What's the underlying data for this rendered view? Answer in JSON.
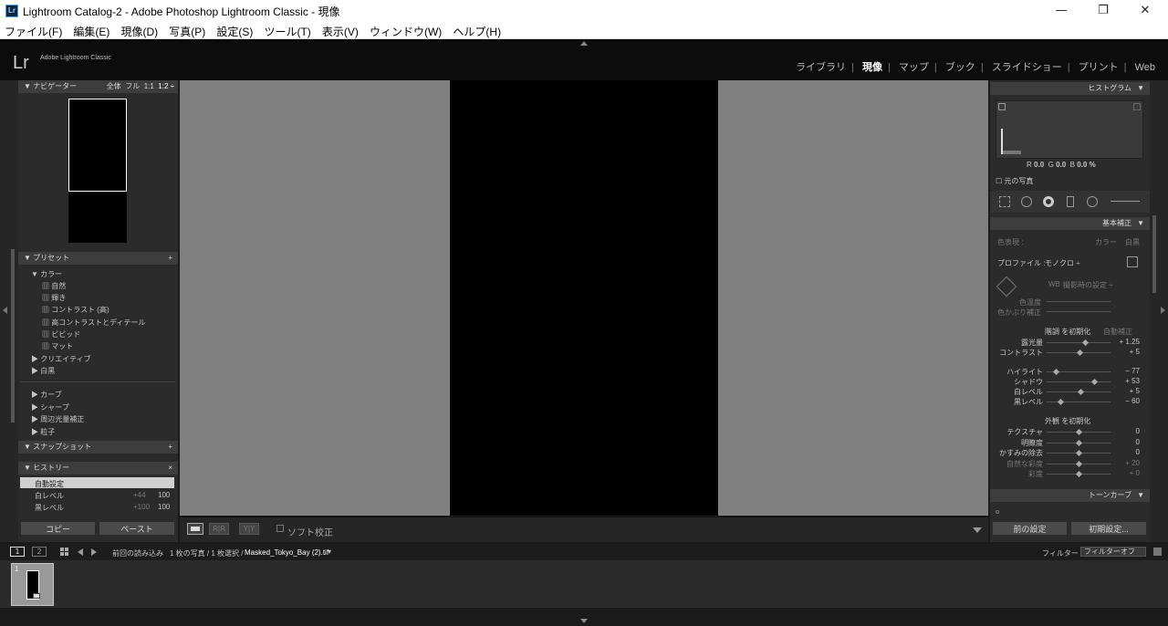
{
  "window": {
    "app_icon": "Lr",
    "title": "Lightroom Catalog-2 - Adobe Photoshop Lightroom Classic - 現像",
    "minimize": "—",
    "maximize": "❐",
    "close": "✕"
  },
  "menu": [
    "ファイル(F)",
    "編集(E)",
    "現像(D)",
    "写真(P)",
    "設定(S)",
    "ツール(T)",
    "表示(V)",
    "ウィンドウ(W)",
    "ヘルプ(H)"
  ],
  "identity": {
    "logo": "Lr",
    "name": "Adobe Lightroom Classic"
  },
  "modules": [
    "ライブラリ",
    "現像",
    "マップ",
    "ブック",
    "スライドショー",
    "プリント",
    "Web"
  ],
  "active_module": "現像",
  "navigator": {
    "title": "ナビゲーター",
    "zoom": [
      "全体",
      "フル",
      "1:1",
      "1:2 ÷"
    ]
  },
  "presets": {
    "title": "プリセット",
    "add": "+",
    "color_group": "カラー",
    "color_items": [
      "自然",
      "輝き",
      "コントラスト (高)",
      "高コントラストとディテール",
      "ビビッド",
      "マット"
    ],
    "groups_a": [
      "クリエイティブ",
      "白黒"
    ],
    "groups_b": [
      "カーブ",
      "シャープ",
      "周辺光量補正",
      "粒子"
    ]
  },
  "snapshots": {
    "title": "スナップショット",
    "add": "+"
  },
  "history": {
    "title": "ヒストリー",
    "close": "×",
    "items": [
      {
        "label": "自動設定",
        "a": "",
        "b": ""
      },
      {
        "label": "白レベル",
        "a": "+44",
        "b": "100"
      },
      {
        "label": "黒レベル",
        "a": "+100",
        "b": "100"
      }
    ]
  },
  "left_buttons": {
    "copy": "コピー",
    "paste": "ペースト"
  },
  "histogram": {
    "title": "ヒストグラム",
    "r_label": "R",
    "r": "0.0",
    "g_label": "G",
    "g": "0.0",
    "b_label": "B",
    "b": "0.0 %",
    "original": "元の写真"
  },
  "basic": {
    "title": "基本補正",
    "treatment_label": "色表現 :",
    "color": "カラー",
    "bw": "白黒",
    "profile_label": "プロファイル :",
    "profile_value": "モノクロ ÷",
    "wb_label": "WB :",
    "wb_value": "撮影時の設定 ÷",
    "temp": "色温度",
    "tint": "色かぶり補正",
    "tone_header": "階調 を初期化",
    "auto": "自動補正",
    "sliders_tone": [
      {
        "label": "露光量",
        "value": "+ 1.25",
        "pos": 0.6
      },
      {
        "label": "コントラスト",
        "value": "+ 5",
        "pos": 0.52
      }
    ],
    "sliders_light": [
      {
        "label": "ハイライト",
        "value": "− 77",
        "pos": 0.12
      },
      {
        "label": "シャドウ",
        "value": "+ 53",
        "pos": 0.76
      },
      {
        "label": "白レベル",
        "value": "+ 5",
        "pos": 0.53
      },
      {
        "label": "黒レベル",
        "value": "− 60",
        "pos": 0.2
      }
    ],
    "presence_header": "外観 を初期化",
    "sliders_presence": [
      {
        "label": "テクスチャ",
        "value": "0",
        "pos": 0.5
      },
      {
        "label": "明瞭度",
        "value": "0",
        "pos": 0.5
      },
      {
        "label": "かすみの除去",
        "value": "0",
        "pos": 0.5
      },
      {
        "label": "自然な彩度",
        "value": "+ 20",
        "pos": 0.5
      },
      {
        "label": "彩度",
        "value": "+ 0",
        "pos": 0.5
      }
    ]
  },
  "tone_curve": {
    "title": "トーンカーブ"
  },
  "right_buttons": {
    "prev": "前の設定",
    "reset": "初期設定..."
  },
  "toolbar": {
    "soft_proof": "ソフト校正",
    "xy": "Y|Y",
    "compare": "R|R"
  },
  "filmstrip_bar": {
    "view1": "1",
    "view2": "2",
    "source": "前回の読み込み",
    "count": "1 枚の写真 / 1 枚選択 /",
    "filename": "Masked_Tokyo_Bay (2).tif",
    "filter_label": "フィルター :",
    "filter_value": "フィルターオフ"
  },
  "thumbnail": {
    "index": "1"
  }
}
